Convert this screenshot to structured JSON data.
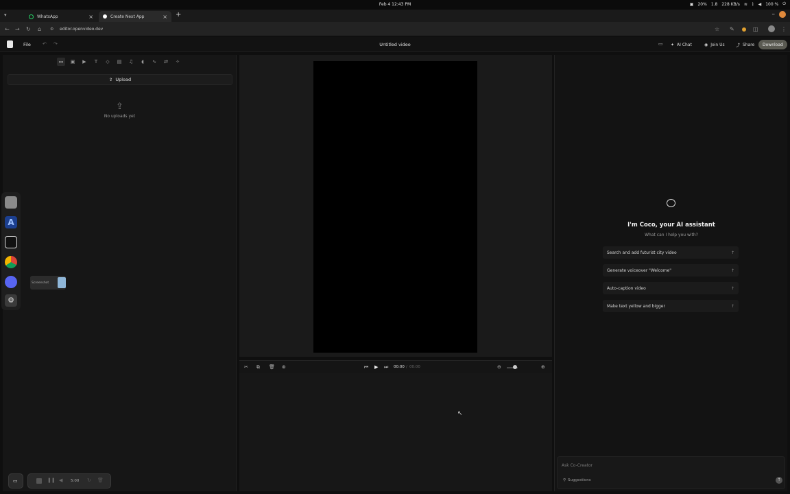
{
  "system_bar": {
    "datetime": "Feb 4  12:43 PM",
    "battery_left": "20%",
    "memory": "1.8",
    "network_speed": "228 KB/s",
    "battery": "100 %"
  },
  "tabs": [
    {
      "label": "WhatsApp",
      "icon": "whatsapp-icon"
    },
    {
      "label": "Create Next App",
      "icon": "nextjs-icon"
    }
  ],
  "address_bar": {
    "url": "editor.openvideo.dev"
  },
  "header": {
    "file_menu": "File",
    "title": "Untitled video",
    "ai_chat": "AI Chat",
    "join_us": "Join Us",
    "share": "Share",
    "download": "Download"
  },
  "left_panel": {
    "upload_label": "Upload",
    "empty_text": "No uploads yet",
    "tools": [
      "folder-icon",
      "image-icon",
      "video-icon",
      "text-icon",
      "shapes-icon",
      "caption-icon",
      "music-icon",
      "mic-icon",
      "effects-icon",
      "transition-icon",
      "sparkle-icon"
    ]
  },
  "drag_chip": {
    "label": "Screenshot"
  },
  "player": {
    "current_time": "00:00",
    "separator": "/",
    "duration": "00:00"
  },
  "assistant": {
    "title": "I'm Coco, your AI assistant",
    "subtitle": "What can I help you with?",
    "suggestions": [
      "Search and add futurist city video",
      "Generate voiceover \"Welcome\"",
      "Auto-caption video",
      "Make text yellow and bigger"
    ],
    "input_placeholder": "Ask Co-Creator",
    "suggestions_label": "Suggestions"
  },
  "recorder": {
    "time": "5:00"
  },
  "colors": {
    "app_bg": "#131313",
    "canvas": "#000000",
    "download_button": "#5a5a52"
  }
}
